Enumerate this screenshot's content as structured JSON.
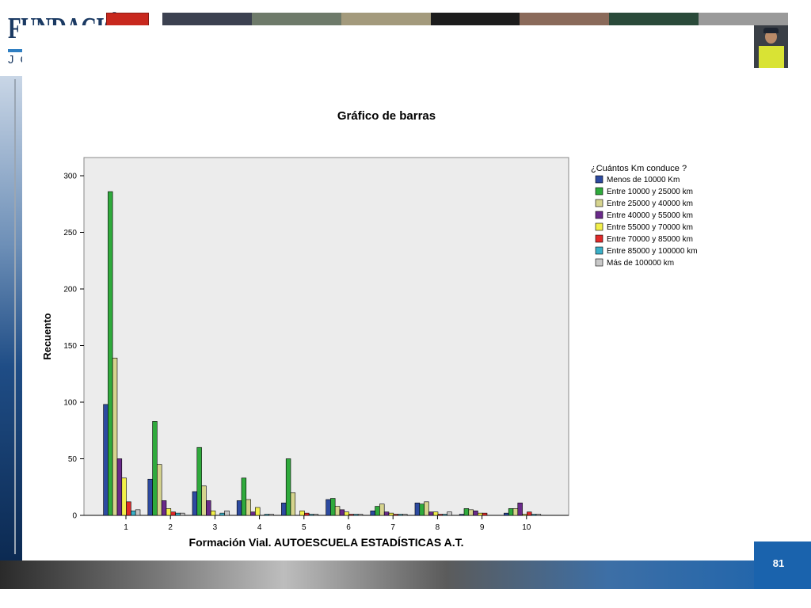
{
  "logo": {
    "title": "FUNDACIÓN",
    "subtitle": "JOSÉ P"
  },
  "page_number": "81",
  "colors": {
    "series": [
      "#2d4aa0",
      "#2faa3c",
      "#d6d48e",
      "#6a2a8a",
      "#f2ef4a",
      "#e02a2a",
      "#3ab0c8",
      "#c8c8c8"
    ],
    "plot_background": "#ececec",
    "brand_blue": "#1a63ad"
  },
  "chart_data": {
    "type": "bar",
    "title": "Gráfico de barras",
    "xlabel": "Formación Vial. AUTOESCUELA ESTADÍSTICAS A.T.",
    "ylabel": "Recuento",
    "ylim": [
      0,
      300
    ],
    "yticks": [
      0,
      50,
      100,
      150,
      200,
      250,
      300
    ],
    "categories": [
      "1",
      "2",
      "3",
      "4",
      "5",
      "6",
      "7",
      "8",
      "9",
      "10"
    ],
    "legend_title": "¿Cuántos Km conduce ?",
    "legend_position": "right",
    "series": [
      {
        "name": "Menos de 10000 Km",
        "values": [
          98,
          32,
          21,
          13,
          11,
          14,
          4,
          11,
          1,
          2
        ]
      },
      {
        "name": "Entre 10000 y 25000 km",
        "values": [
          286,
          83,
          60,
          33,
          50,
          15,
          8,
          10,
          6,
          6
        ]
      },
      {
        "name": "Entre 25000 y 40000 km",
        "values": [
          139,
          45,
          26,
          14,
          20,
          8,
          10,
          12,
          5,
          6
        ]
      },
      {
        "name": "Entre 40000 y 55000 km",
        "values": [
          50,
          13,
          13,
          3,
          0,
          5,
          3,
          3,
          4,
          11
        ]
      },
      {
        "name": "Entre 55000 y 70000 km",
        "values": [
          33,
          6,
          4,
          7,
          4,
          3,
          2,
          3,
          2,
          1
        ]
      },
      {
        "name": "Entre 70000 y 85000 km",
        "values": [
          12,
          3,
          0,
          0,
          2,
          1,
          1,
          1,
          2,
          3
        ]
      },
      {
        "name": "Entre 85000 y 100000 km",
        "values": [
          4,
          2,
          2,
          1,
          1,
          1,
          1,
          1,
          0,
          1
        ]
      },
      {
        "name": "Más de 100000 km",
        "values": [
          5,
          2,
          4,
          1,
          1,
          1,
          1,
          3,
          0,
          1
        ]
      }
    ]
  }
}
